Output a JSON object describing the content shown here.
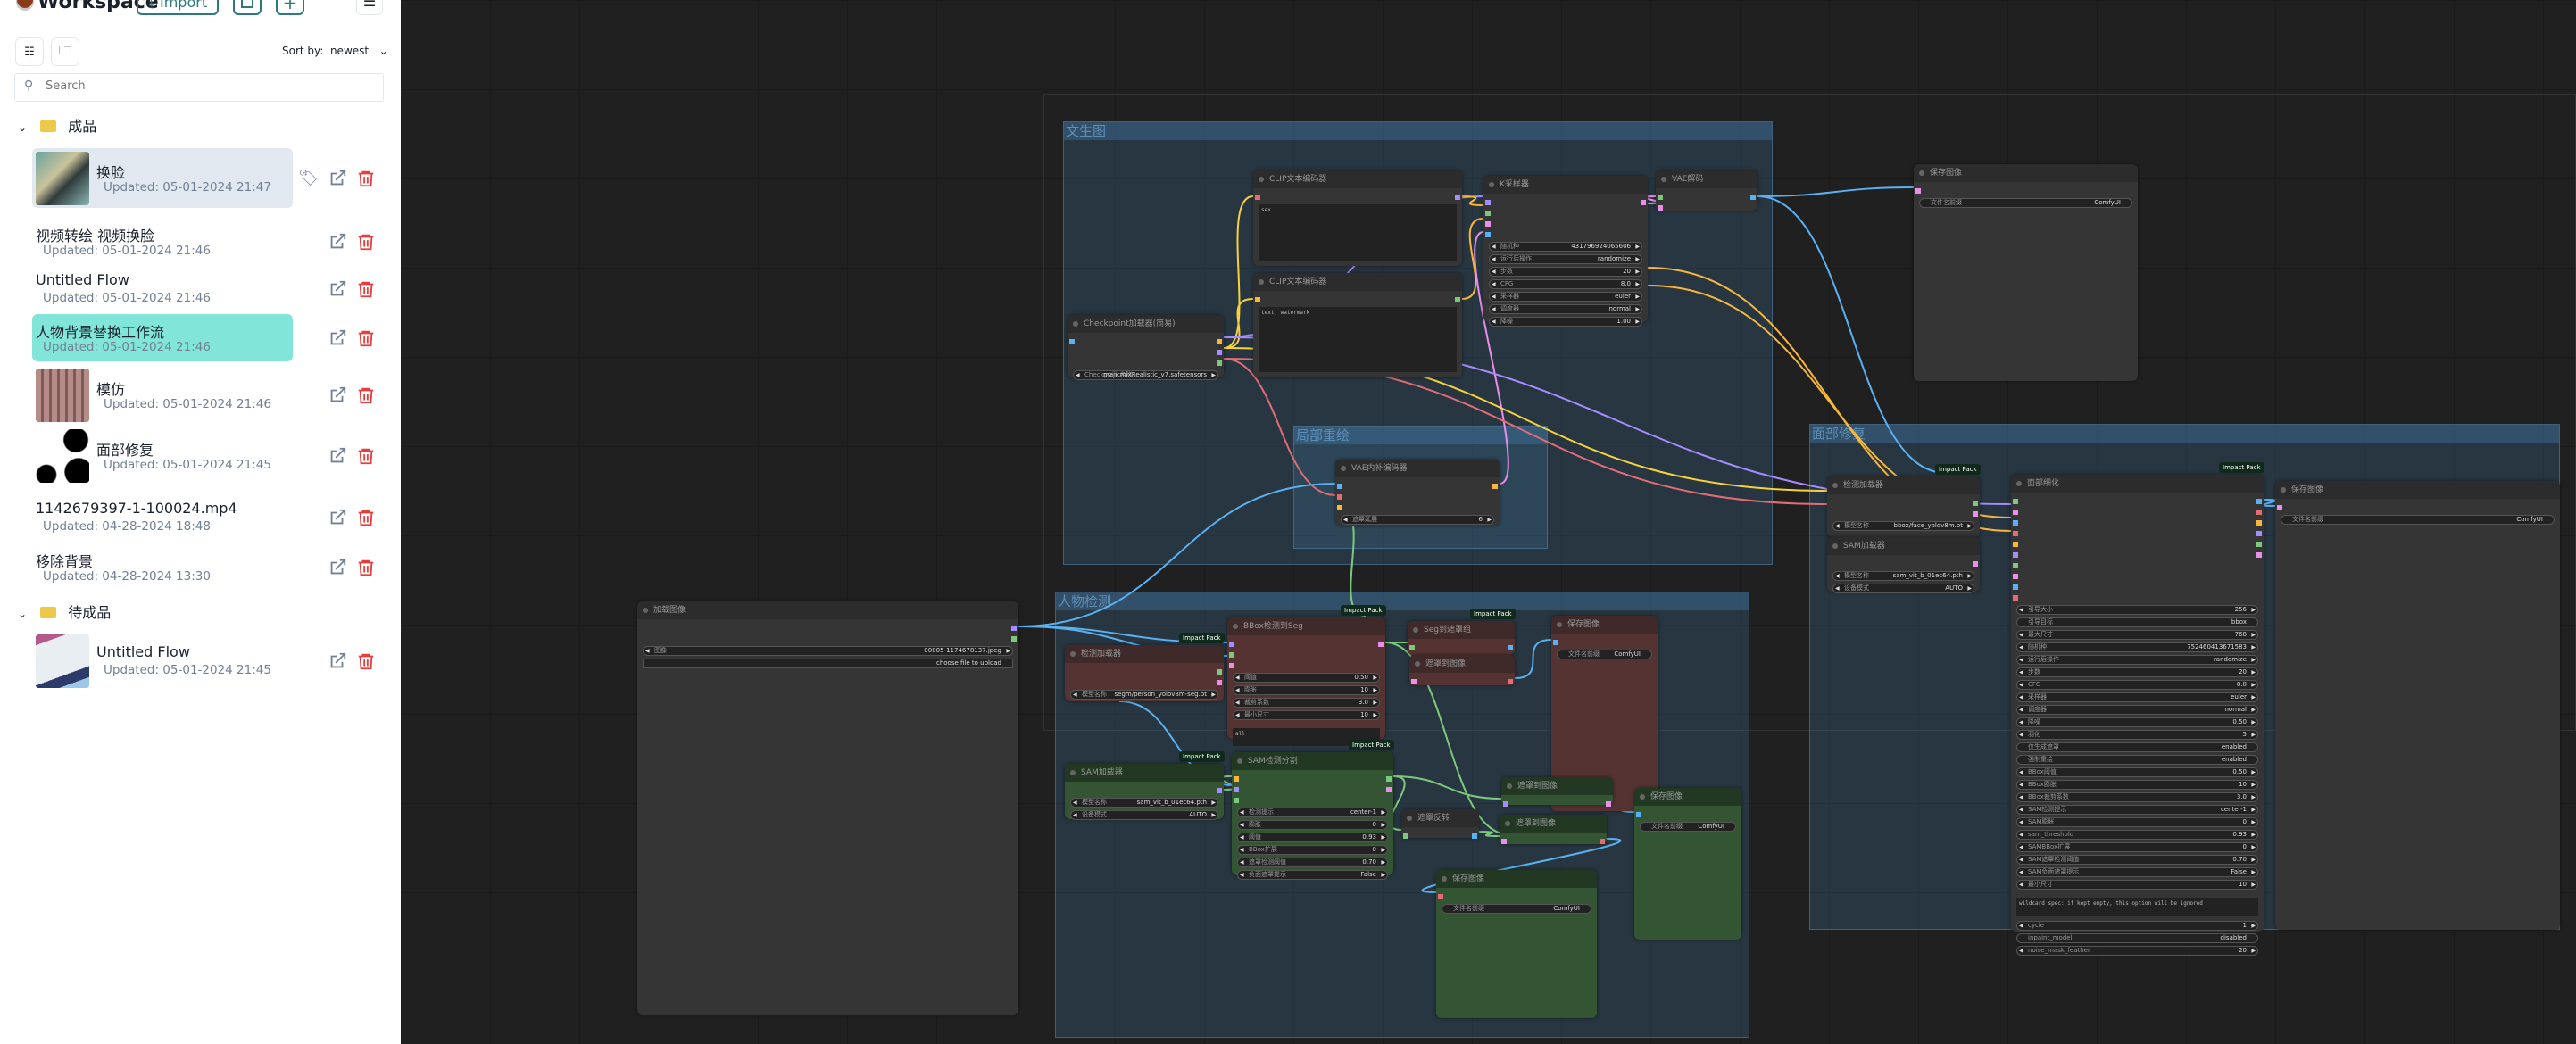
{
  "sidebar": {
    "title": "Workspace",
    "import_label": "Import",
    "sort_label": "Sort by:",
    "sort_value": "newest",
    "search_placeholder": "Search",
    "folders": [
      {
        "name": "成品",
        "items": [
          {
            "title": "换脸",
            "updated": "Updated: 05-01-2024 21:47",
            "thumb": "anime-girl",
            "selected": true
          },
          {
            "title": "视频转绘 视频换脸",
            "updated": "Updated: 05-01-2024 21:46"
          },
          {
            "title": "Untitled Flow",
            "updated": "Updated: 05-01-2024 21:46"
          },
          {
            "title": "人物背景替换工作流",
            "updated": "Updated: 05-01-2024 21:46",
            "active": true
          },
          {
            "title": "模仿",
            "updated": "Updated: 05-01-2024 21:46",
            "thumb": "kimono"
          },
          {
            "title": "面部修复",
            "updated": "Updated: 05-01-2024 21:45",
            "thumb": "mask"
          },
          {
            "title": "1142679397-1-100024.mp4",
            "updated": "Updated: 04-28-2024 18:48"
          },
          {
            "title": "移除背景",
            "updated": "Updated: 04-28-2024 13:30"
          }
        ]
      },
      {
        "name": "待成品",
        "items": [
          {
            "title": "Untitled Flow",
            "updated": "Updated: 05-01-2024 21:45",
            "thumb": "polar-bear"
          }
        ]
      }
    ],
    "colors": {
      "accent": "#2c7a7b",
      "selected": "#e2e8f0",
      "active": "#81e6d9",
      "delete": "#e53e3e",
      "folder": "#ecc94b"
    }
  },
  "canvas": {
    "groups": [
      {
        "id": "g1",
        "title": "文生图"
      },
      {
        "id": "g2",
        "title": "局部重绘"
      },
      {
        "id": "g3",
        "title": "人物检测"
      },
      {
        "id": "g4",
        "title": "面部修复"
      }
    ],
    "badge": "Impact Pack",
    "nodes": [
      {
        "id": "ckpt",
        "title": "Checkpoint加载器(简易)",
        "widgets": [
          {
            "l": "Checkpoint名称",
            "v": "majicmixRealistic_v7.safetensors"
          }
        ]
      },
      {
        "id": "clip1",
        "title": "CLIP文本编码器",
        "text": "sex"
      },
      {
        "id": "clip2",
        "title": "CLIP文本编码器",
        "text": "text, watermark"
      },
      {
        "id": "ksampler",
        "title": "K采样器",
        "widgets": [
          {
            "l": "随机种",
            "v": "431796924065606"
          },
          {
            "l": "运行后操作",
            "v": "randomize"
          },
          {
            "l": "步数",
            "v": "20"
          },
          {
            "l": "CFG",
            "v": "8.0"
          },
          {
            "l": "采样器",
            "v": "euler"
          },
          {
            "l": "调度器",
            "v": "normal"
          },
          {
            "l": "降噪",
            "v": "1.00"
          }
        ]
      },
      {
        "id": "vaedec",
        "title": "VAE解码"
      },
      {
        "id": "save1",
        "title": "保存图像",
        "widgets": [
          {
            "l": "文件名前缀",
            "v": "ComfyUI",
            "t": "tg"
          }
        ]
      },
      {
        "id": "vaeenc",
        "title": "VAE内补编码器",
        "widgets": [
          {
            "l": "遮罩延展",
            "v": "6"
          }
        ]
      },
      {
        "id": "loadimg",
        "title": "加载图像",
        "widgets": [
          {
            "l": "图像",
            "v": "00005-1174678137.jpeg"
          },
          {
            "l": "",
            "v": "choose file to upload",
            "t": "btnw"
          }
        ]
      },
      {
        "id": "det1",
        "title": "检测加载器",
        "color": "red",
        "badge": true,
        "widgets": [
          {
            "l": "模型名称",
            "v": "segm/person_yolov8m-seg.pt"
          }
        ]
      },
      {
        "id": "bbox",
        "title": "BBox检测到Seg",
        "color": "red",
        "badge": true,
        "widgets": [
          {
            "l": "阈值",
            "v": "0.50"
          },
          {
            "l": "膨胀",
            "v": "10"
          },
          {
            "l": "裁剪系数",
            "v": "3.0"
          },
          {
            "l": "最小尺寸",
            "v": "10"
          }
        ],
        "text": "all"
      },
      {
        "id": "seg2mask",
        "title": "Seg到遮罩组",
        "color": "red",
        "badge": true
      },
      {
        "id": "m2i1",
        "title": "遮罩到图像",
        "color": "red"
      },
      {
        "id": "save2",
        "title": "保存图像",
        "color": "red",
        "widgets": [
          {
            "l": "文件名前缀",
            "v": "ComfyUI",
            "t": "tg"
          }
        ]
      },
      {
        "id": "sam1",
        "title": "SAM加载器",
        "color": "green",
        "badge": true,
        "widgets": [
          {
            "l": "模型名称",
            "v": "sam_vit_b_01ec64.pth"
          },
          {
            "l": "设备模式",
            "v": "AUTO"
          }
        ]
      },
      {
        "id": "samdet",
        "title": "SAM检测分割",
        "color": "green",
        "badge": true,
        "widgets": [
          {
            "l": "检测提示",
            "v": "center-1"
          },
          {
            "l": "膨胀",
            "v": "0"
          },
          {
            "l": "阈值",
            "v": "0.93"
          },
          {
            "l": "BBox扩展",
            "v": "0"
          },
          {
            "l": "遮罩检测阈值",
            "v": "0.70"
          },
          {
            "l": "负面遮罩提示",
            "v": "False"
          }
        ]
      },
      {
        "id": "m2i2",
        "title": "遮罩到图像",
        "color": "green"
      },
      {
        "id": "invert",
        "title": "遮罩反转"
      },
      {
        "id": "m2i3",
        "title": "遮罩到图像",
        "color": "green"
      },
      {
        "id": "save3",
        "title": "保存图像",
        "color": "green",
        "widgets": [
          {
            "l": "文件名前缀",
            "v": "ComfyUI",
            "t": "tg"
          }
        ]
      },
      {
        "id": "save4",
        "title": "保存图像",
        "color": "green",
        "widgets": [
          {
            "l": "文件名前缀",
            "v": "ComfyUI",
            "t": "tg"
          }
        ]
      },
      {
        "id": "det2",
        "title": "检测加载器",
        "badge": true,
        "widgets": [
          {
            "l": "模型名称",
            "v": "bbox/face_yolov8m.pt"
          }
        ]
      },
      {
        "id": "sam2",
        "title": "SAM加载器",
        "widgets": [
          {
            "l": "模型名称",
            "v": "sam_vit_b_01ec64.pth"
          },
          {
            "l": "设备模式",
            "v": "AUTO"
          }
        ]
      },
      {
        "id": "face",
        "title": "面部细化",
        "badge": true,
        "widgets": [
          {
            "l": "引导大小",
            "v": "256"
          },
          {
            "l": "引导目标",
            "v": "bbox",
            "t": "tg"
          },
          {
            "l": "最大尺寸",
            "v": "768"
          },
          {
            "l": "随机种",
            "v": "752460413671583"
          },
          {
            "l": "运行后操作",
            "v": "randomize"
          },
          {
            "l": "步数",
            "v": "20"
          },
          {
            "l": "CFG",
            "v": "8.0"
          },
          {
            "l": "采样器",
            "v": "euler"
          },
          {
            "l": "调度器",
            "v": "normal"
          },
          {
            "l": "降噪",
            "v": "0.50"
          },
          {
            "l": "羽化",
            "v": "5"
          },
          {
            "l": "仅生成遮罩",
            "v": "enabled",
            "t": "tg"
          },
          {
            "l": "强制重绘",
            "v": "enabled",
            "t": "tg"
          },
          {
            "l": "BBox阈值",
            "v": "0.50"
          },
          {
            "l": "BBox膨胀",
            "v": "10"
          },
          {
            "l": "BBox裁剪系数",
            "v": "3.0"
          },
          {
            "l": "SAM检测提示",
            "v": "center-1"
          },
          {
            "l": "SAM膨胀",
            "v": "0"
          },
          {
            "l": "sam_threshold",
            "v": "0.93"
          },
          {
            "l": "SAMBBox扩展",
            "v": "0"
          },
          {
            "l": "SAM遮罩检测阈值",
            "v": "0.70"
          },
          {
            "l": "SAM负面遮罩提示",
            "v": "False"
          },
          {
            "l": "最小尺寸",
            "v": "10"
          }
        ],
        "text": "wildcard spec: if kept empty, this option will be ignored",
        "widgets2": [
          {
            "l": "cycle",
            "v": "1"
          },
          {
            "l": "inpaint_model",
            "v": "disabled",
            "t": "tg"
          },
          {
            "l": "noise_mask_feather",
            "v": "20"
          }
        ]
      },
      {
        "id": "save5",
        "title": "保存图像",
        "widgets": [
          {
            "l": "文件名前缀",
            "v": "ComfyUI",
            "t": "tg"
          }
        ]
      }
    ]
  }
}
